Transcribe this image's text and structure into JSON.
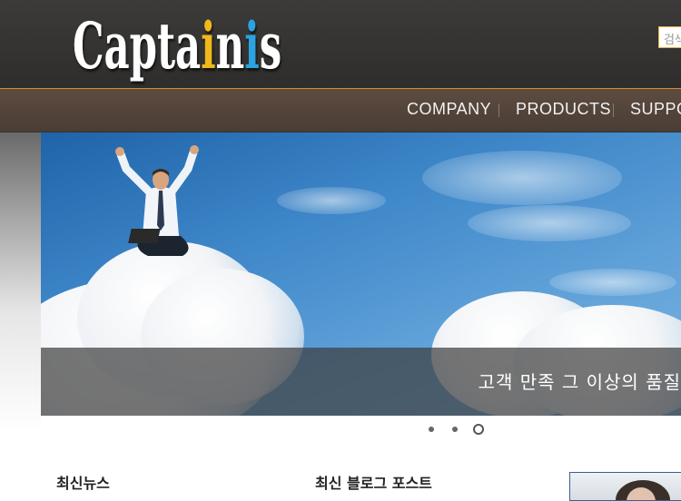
{
  "header": {
    "logo": {
      "part1": "Capta",
      "accent1": "i",
      "part2": "n",
      "accent2": "i",
      "part3": "s"
    },
    "search_placeholder": "검색"
  },
  "nav": {
    "items": [
      "COMPANY",
      "PRODUCTS",
      "SUPPORT"
    ]
  },
  "hero": {
    "caption": "고객 만족 그 이상의 품질"
  },
  "slider": {
    "count": 3,
    "active_index": 2
  },
  "sections": {
    "news_title": "최신뉴스",
    "blog_title": "최신 블로그 포스트"
  },
  "colors": {
    "accent_line": "#d98a2a",
    "logo_yellow": "#f0b81c",
    "logo_blue": "#2aa3e0",
    "nav_bg": "#4a3d34"
  }
}
